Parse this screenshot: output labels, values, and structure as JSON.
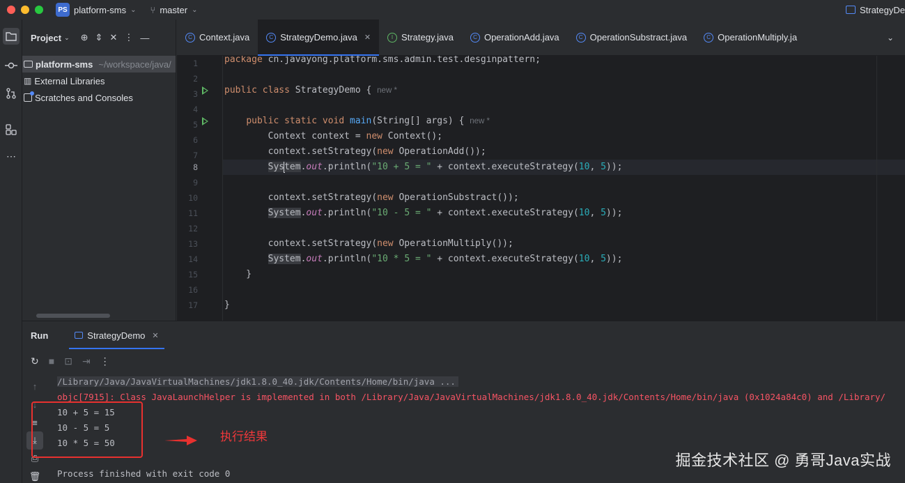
{
  "titlebar": {
    "project_badge": "PS",
    "project_name": "platform-sms",
    "branch": "master",
    "right_title": "StrategyDe"
  },
  "project_panel": {
    "title": "Project",
    "items": [
      {
        "label": "platform-sms",
        "path": "~/workspace/java/"
      },
      {
        "label": "External Libraries"
      },
      {
        "label": "Scratches and Consoles"
      }
    ]
  },
  "tabs": [
    {
      "label": "Context.java",
      "icon": "class-icon"
    },
    {
      "label": "StrategyDemo.java",
      "icon": "class-icon",
      "active": true
    },
    {
      "label": "Strategy.java",
      "icon": "interface-icon"
    },
    {
      "label": "OperationAdd.java",
      "icon": "class-icon"
    },
    {
      "label": "OperationSubstract.java",
      "icon": "class-icon"
    },
    {
      "label": "OperationMultiply.ja",
      "icon": "class-icon"
    }
  ],
  "editor": {
    "current_line": 8,
    "line_numbers": [
      "1",
      "2",
      "3",
      "4",
      "5",
      "6",
      "7",
      "8",
      "9",
      "10",
      "11",
      "12",
      "13",
      "14",
      "15",
      "16",
      "17"
    ],
    "hint_new": "new *",
    "lines": {
      "l1_kw": "package",
      "l1_rest": " cn.javayong.platform.sms.admin.test.desginpattern;",
      "l3_kw": "public class",
      "l3_rest": " StrategyDemo { ",
      "l5_indent": "    ",
      "l5_kw": "public static void",
      "l5_fn": " main",
      "l5_rest": "(String[] args) { ",
      "l6_a": "        Context context = ",
      "l6_kw": "new",
      "l6_b": " Context();",
      "l7_a": "        context.setStrategy(",
      "l7_kw": "new",
      "l7_b": " OperationAdd());",
      "l8_indent": "        ",
      "l8_sys1": "Sys",
      "l8_sys2": "tem",
      "l8_dot": ".",
      "l8_out": "out",
      "l8_print": ".println(",
      "l8_str": "\"10 + 5 = \"",
      "l8_mid": " + context.executeStrategy(",
      "l8_n1": "10",
      "l8_comma": ", ",
      "l8_n2": "5",
      "l8_end": "));",
      "l10_a": "        context.setStrategy(",
      "l10_kw": "new",
      "l10_b": " OperationSubstract());",
      "l11_indent": "        ",
      "l11_sys": "System",
      "l11_dot": ".",
      "l11_out": "out",
      "l11_print": ".println(",
      "l11_str": "\"10 - 5 = \"",
      "l11_mid": " + context.executeStrategy(",
      "l11_n1": "10",
      "l11_comma": ", ",
      "l11_n2": "5",
      "l11_end": "));",
      "l13_a": "        context.setStrategy(",
      "l13_kw": "new",
      "l13_b": " OperationMultiply());",
      "l14_indent": "        ",
      "l14_sys": "System",
      "l14_dot": ".",
      "l14_out": "out",
      "l14_print": ".println(",
      "l14_str": "\"10 * 5 = \"",
      "l14_mid": " + context.executeStrategy(",
      "l14_n1": "10",
      "l14_comma": ", ",
      "l14_n2": "5",
      "l14_end": "));",
      "l15": "    }",
      "l17": "}"
    }
  },
  "run_panel": {
    "title": "Run",
    "tab_label": "StrategyDemo",
    "console": [
      {
        "type": "cmd",
        "text": "/Library/Java/JavaVirtualMachines/jdk1.8.0_40.jdk/Contents/Home/bin/java ..."
      },
      {
        "type": "err",
        "text": "objc[7915]: Class JavaLaunchHelper is implemented in both /Library/Java/JavaVirtualMachines/jdk1.8.0_40.jdk/Contents/Home/bin/java (0x1024a84c0) and /Library/"
      },
      {
        "type": "out",
        "text": "10 + 5 = 15"
      },
      {
        "type": "out",
        "text": "10 - 5 = 5"
      },
      {
        "type": "out",
        "text": "10 * 5 = 50"
      },
      {
        "type": "out",
        "text": ""
      },
      {
        "type": "out",
        "text": "Process finished with exit code 0"
      }
    ]
  },
  "annotation": {
    "label": "执行结果",
    "color": "#e8312f"
  },
  "watermark": "掘金技术社区 @ 勇哥Java实战"
}
